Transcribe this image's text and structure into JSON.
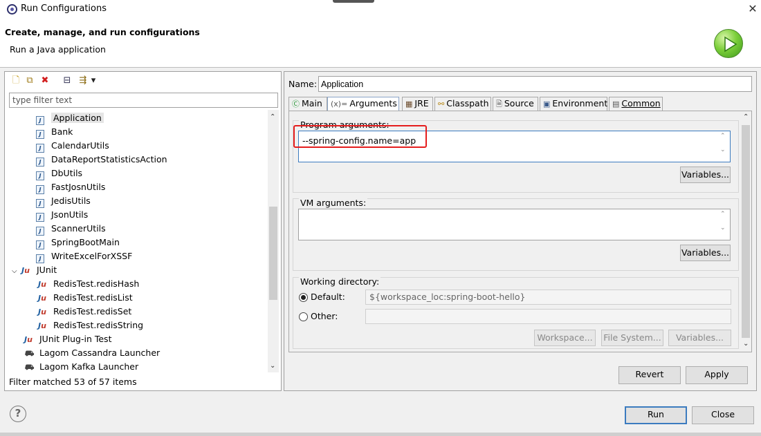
{
  "window": {
    "title": "Run Configurations",
    "close_glyph": "✕"
  },
  "header": {
    "title": "Create, manage, and run configurations",
    "subtitle": "Run a Java application",
    "logo_icon": "run-launch-icon"
  },
  "left": {
    "toolbar": [
      {
        "name": "new-launch-config-icon",
        "glyph": "🗋"
      },
      {
        "name": "duplicate-config-icon",
        "glyph": "⧉"
      },
      {
        "name": "delete-config-icon",
        "glyph": "✖"
      },
      {
        "name": "collapse-all-icon",
        "glyph": "⊟"
      },
      {
        "name": "filter-config-icon",
        "glyph": "⇶"
      },
      {
        "name": "view-menu-dropdown-icon",
        "glyph": "▾"
      }
    ],
    "filter_placeholder": "type filter text",
    "tree": {
      "java_apps": [
        "Application",
        "Bank",
        "CalendarUtils",
        "DataReportStatisticsAction",
        "DbUtils",
        "FastJosnUtils",
        "JedisUtils",
        "JsonUtils",
        "ScannerUtils",
        "SpringBootMain",
        "WriteExcelForXSSF"
      ],
      "junit_label": "JUnit",
      "junit_tests": [
        "RedisTest.redisHash",
        "RedisTest.redisList",
        "RedisTest.redisSet",
        "RedisTest.redisString"
      ],
      "plugin_test": "JUnit Plug-in Test",
      "cassandra": "Lagom Cassandra Launcher",
      "kafka": "Lagom Kafka Launcher"
    },
    "status": "Filter matched 53 of 57 items"
  },
  "right": {
    "name_label": "Name:",
    "name_value": "Application",
    "tabs": {
      "main": "Main",
      "arguments": "Arguments",
      "jre": "JRE",
      "classpath": "Classpath",
      "source": "Source",
      "environment": "Environment",
      "common": "Common"
    },
    "program_args_label": "Program arguments:",
    "program_args_value": "--spring-config.name=app",
    "vm_args_label": "VM arguments:",
    "vm_args_value": "",
    "variables_label": "Variables...",
    "working_dir_label": "Working directory:",
    "default_label": "Default:",
    "default_value": "${workspace_loc:spring-boot-hello}",
    "other_label": "Other:",
    "workspace_btn": "Workspace...",
    "filesystem_btn": "File System...",
    "variables_btn": "Variables...",
    "revert": "Revert",
    "apply": "Apply"
  },
  "footer": {
    "run": "Run",
    "close": "Close",
    "help_glyph": "?"
  }
}
